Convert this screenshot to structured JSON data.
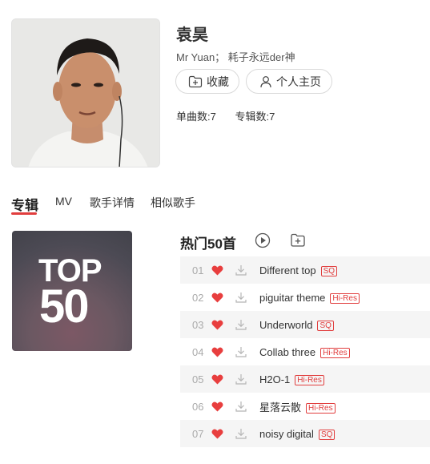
{
  "artist": {
    "name": "袁昊",
    "aliases": "Mr Yuan； 耗子永远der神",
    "collect_label": "收藏",
    "homepage_label": "个人主页",
    "singles_label": "单曲数:7",
    "albums_label": "专辑数:7"
  },
  "tabs": [
    {
      "label": "专辑",
      "active": true
    },
    {
      "label": "MV",
      "active": false
    },
    {
      "label": "歌手详情",
      "active": false
    },
    {
      "label": "相似歌手",
      "active": false
    }
  ],
  "cover": {
    "line1": "TOP",
    "line2": "50"
  },
  "hot": {
    "title": "热门50首"
  },
  "songs": [
    {
      "num": "01",
      "title": "Different top",
      "badge": "SQ",
      "liked": true
    },
    {
      "num": "02",
      "title": "piguitar theme",
      "badge": "Hi-Res",
      "liked": true
    },
    {
      "num": "03",
      "title": "Underworld",
      "badge": "SQ",
      "liked": true
    },
    {
      "num": "04",
      "title": "Collab three",
      "badge": "Hi-Res",
      "liked": true
    },
    {
      "num": "05",
      "title": "H2O-1",
      "badge": "Hi-Res",
      "liked": true
    },
    {
      "num": "06",
      "title": "星落云散",
      "badge": "Hi-Res",
      "liked": true
    },
    {
      "num": "07",
      "title": "noisy digital",
      "badge": "SQ",
      "liked": true
    }
  ],
  "colors": {
    "accent": "#e13e3e",
    "heart": "#e83e3e",
    "row_alt": "#f5f5f5"
  },
  "icons": [
    "heart-icon",
    "download-icon",
    "play-icon",
    "add-icon",
    "user-icon"
  ]
}
